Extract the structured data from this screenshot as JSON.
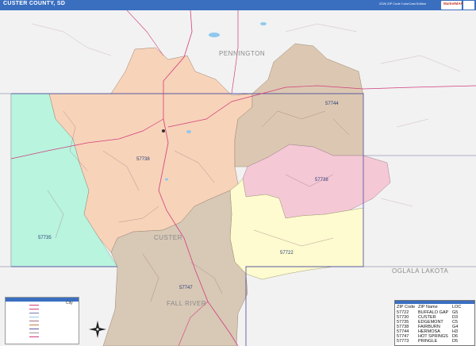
{
  "header": {
    "title": "CUSTER COUNTY, SD",
    "edition": "2026 ZIP Code ColorCast Edition",
    "logo_text": "MarketMAPS"
  },
  "map": {
    "region_labels": [
      "PENNINGTON",
      "OGLALA LAKOTA",
      "FALL RIVER",
      "CUSTER"
    ],
    "zip_labels": [
      "57744",
      "57738",
      "57738",
      "57735",
      "57722",
      "57747"
    ],
    "colors": {
      "zip_57738": "#f7d3b9",
      "zip_57744": "#dcc8b2",
      "zip_57730": "#f5c8d6",
      "zip_57722": "#fdfbcf",
      "zip_57735": "#b8f4de",
      "zip_57747": "#d8c8b6",
      "outside": "#f2f2f2",
      "boundary": "#5a5aa0",
      "roads": "#d23c7c",
      "water": "#8fc8ee"
    }
  },
  "legend": {
    "city_label": "City"
  },
  "zip_table": {
    "headers": [
      "ZIP Code",
      "ZIP Name",
      "LOC"
    ],
    "rows": [
      [
        "57722",
        "BUFFALO GAP",
        "G5"
      ],
      [
        "57730",
        "CUSTER",
        "D3"
      ],
      [
        "57735",
        "EDGEMONT",
        "C5"
      ],
      [
        "57738",
        "FAIRBURN",
        "G4"
      ],
      [
        "57744",
        "HERMOSA",
        "H3"
      ],
      [
        "57747",
        "HOT SPRINGS",
        "D6"
      ],
      [
        "57773",
        "PRINGLE",
        "D5"
      ]
    ]
  }
}
